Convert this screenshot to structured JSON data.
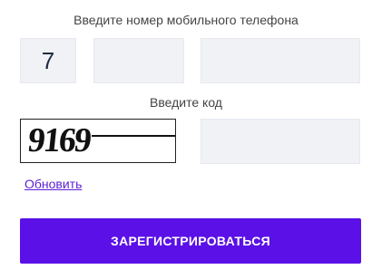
{
  "form": {
    "phone_label": "Введите номер мобильного телефона",
    "country_code": "7",
    "operator_code": "",
    "phone_number": "",
    "code_label": "Введите код",
    "captcha_text": "9169",
    "code_value": "",
    "refresh_label": "Обновить",
    "submit_label": "ЗАРЕГИСТРИРОВАТЬСЯ"
  },
  "colors": {
    "accent": "#5a10e6",
    "link": "#5b1fd6",
    "input_bg": "#f0f2f6"
  }
}
